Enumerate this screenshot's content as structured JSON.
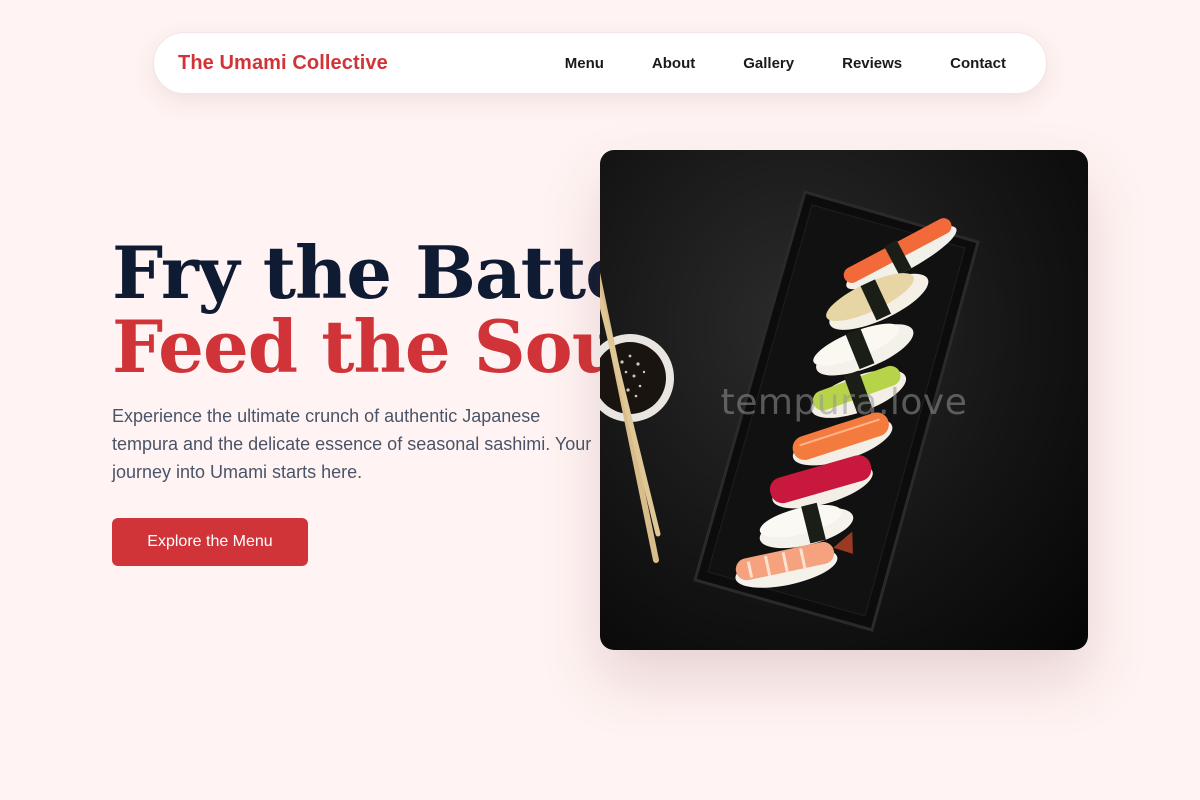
{
  "header": {
    "brand": "The Umami Collective",
    "nav": [
      {
        "label": "Menu"
      },
      {
        "label": "About"
      },
      {
        "label": "Gallery"
      },
      {
        "label": "Reviews"
      },
      {
        "label": "Contact"
      }
    ]
  },
  "hero": {
    "title_line1": "Fry the Batter,",
    "title_line2": "Feed the Soul.",
    "subtitle": "Experience the ultimate crunch of authentic Japanese tempura and the delicate essence of seasonal sashimi. Your journey into Umami starts here.",
    "cta_label": "Explore the Menu"
  },
  "image": {
    "watermark": "tempura.love"
  },
  "colors": {
    "accent": "#d13438",
    "heading": "#0f1b33",
    "background": "#fff4f3"
  }
}
